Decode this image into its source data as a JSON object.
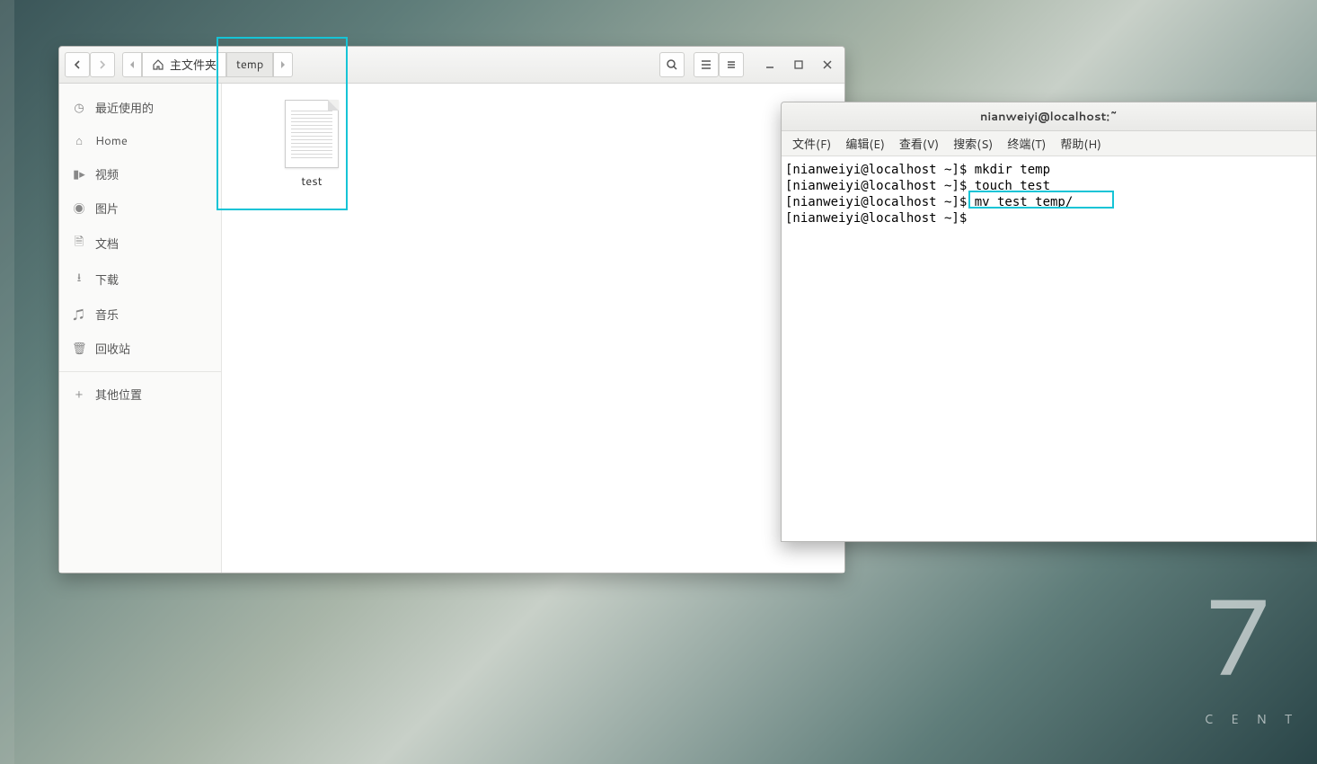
{
  "desktop": {
    "os_watermark_big": "7",
    "os_watermark_small": "C E N T"
  },
  "nautilus": {
    "path": {
      "home_label": "主文件夹",
      "current": "temp"
    },
    "sidebar": {
      "items": [
        {
          "label": "最近使用的"
        },
        {
          "label": "Home"
        },
        {
          "label": "视频"
        },
        {
          "label": "图片"
        },
        {
          "label": "文档"
        },
        {
          "label": "下载"
        },
        {
          "label": "音乐"
        },
        {
          "label": "回收站"
        }
      ],
      "other_label": "其他位置"
    },
    "content": {
      "files": [
        {
          "name": "test"
        }
      ]
    }
  },
  "terminal": {
    "title": "nianweiyi@localhost:~",
    "menus": [
      {
        "label": "文件(F)"
      },
      {
        "label": "编辑(E)"
      },
      {
        "label": "查看(V)"
      },
      {
        "label": "搜索(S)"
      },
      {
        "label": "终端(T)"
      },
      {
        "label": "帮助(H)"
      }
    ],
    "lines": [
      {
        "prompt": "[nianweiyi@localhost ~]$ ",
        "cmd": "mkdir temp"
      },
      {
        "prompt": "[nianweiyi@localhost ~]$ ",
        "cmd": "touch test"
      },
      {
        "prompt": "[nianweiyi@localhost ~]$ ",
        "cmd": "mv test temp/"
      },
      {
        "prompt": "[nianweiyi@localhost ~]$ ",
        "cmd": ""
      }
    ]
  }
}
